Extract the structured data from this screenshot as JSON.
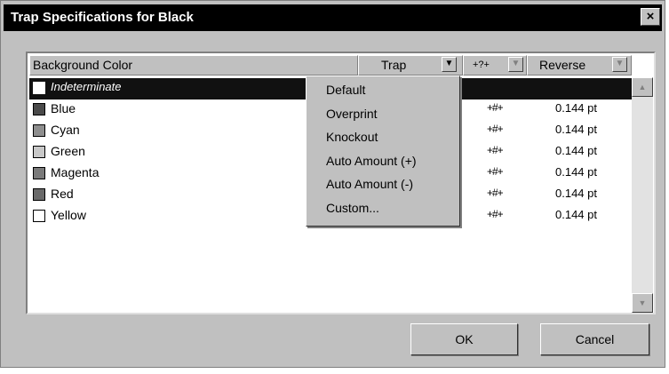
{
  "dialog": {
    "title": "Trap Specifications for Black",
    "close_glyph": "×"
  },
  "columns": {
    "background_color": "Background Color",
    "trap": "Trap",
    "direction": "+?+",
    "reverse": "Reverse",
    "dropdown_glyph": "▼"
  },
  "rows": [
    {
      "name": "Indeterminate",
      "swatch": "#ffffff",
      "symbol": "",
      "reverse": ""
    },
    {
      "name": "Blue",
      "swatch": "#4a4a4a",
      "symbol": "+#+",
      "reverse": "0.144 pt"
    },
    {
      "name": "Cyan",
      "swatch": "#8e8e8e",
      "symbol": "+#+",
      "reverse": "0.144 pt"
    },
    {
      "name": "Green",
      "swatch": "#c8c8c8",
      "symbol": "+#+",
      "reverse": "0.144 pt"
    },
    {
      "name": "Magenta",
      "swatch": "#7a7a7a",
      "symbol": "+#+",
      "reverse": "0.144 pt"
    },
    {
      "name": "Red",
      "swatch": "#6a6a6a",
      "symbol": "+#+",
      "reverse": "0.144 pt"
    },
    {
      "name": "Yellow",
      "swatch": "#ffffff",
      "symbol": "+#+",
      "reverse": "0.144 pt"
    }
  ],
  "scrollbar": {
    "up_glyph": "▲",
    "down_glyph": "▼"
  },
  "trap_menu": {
    "items": [
      "Default",
      "Overprint",
      "Knockout",
      "Auto Amount (+)",
      "Auto Amount (-)",
      "Custom..."
    ]
  },
  "buttons": {
    "ok": "OK",
    "cancel": "Cancel"
  }
}
